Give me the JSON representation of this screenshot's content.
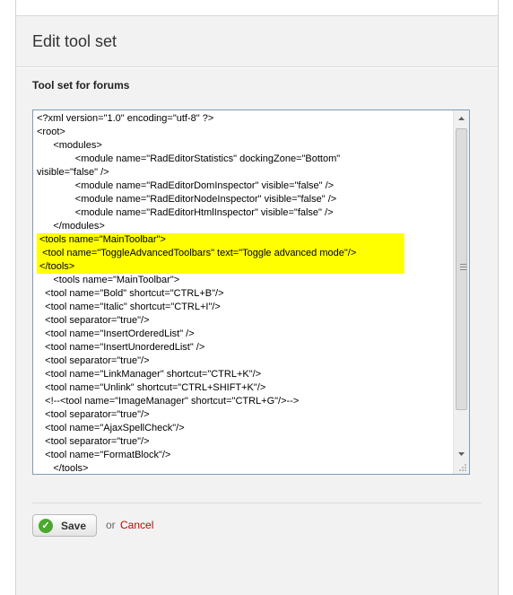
{
  "dialog": {
    "title": "Edit tool set",
    "section_label": "Tool set for forums"
  },
  "editor": {
    "lines": [
      {
        "text": "<?xml version=\"1.0\" encoding=\"utf-8\" ?>",
        "highlight": false
      },
      {
        "text": "<root>",
        "highlight": false
      },
      {
        "text": "      <modules>",
        "highlight": false
      },
      {
        "text": "              <module name=\"RadEditorStatistics\" dockingZone=\"Bottom\"",
        "highlight": false
      },
      {
        "text": "visible=\"false\" />",
        "highlight": false
      },
      {
        "text": "              <module name=\"RadEditorDomInspector\" visible=\"false\" />",
        "highlight": false
      },
      {
        "text": "              <module name=\"RadEditorNodeInspector\" visible=\"false\" />",
        "highlight": false
      },
      {
        "text": "              <module name=\"RadEditorHtmlInspector\" visible=\"false\" />",
        "highlight": false
      },
      {
        "text": "      </modules>",
        "highlight": false
      },
      {
        "text": " <tools name=\"MainToolbar\">",
        "highlight": true
      },
      {
        "text": "  <tool name=\"ToggleAdvancedToolbars\" text=\"Toggle advanced mode\"/>",
        "highlight": true
      },
      {
        "text": " </tools>",
        "highlight": true
      },
      {
        "text": "      <tools name=\"MainToolbar\">",
        "highlight": false
      },
      {
        "text": "   <tool name=\"Bold\" shortcut=\"CTRL+B\"/>",
        "highlight": false
      },
      {
        "text": "   <tool name=\"Italic\" shortcut=\"CTRL+I\"/>",
        "highlight": false
      },
      {
        "text": "   <tool separator=\"true\"/>",
        "highlight": false
      },
      {
        "text": "   <tool name=\"InsertOrderedList\" />",
        "highlight": false
      },
      {
        "text": "   <tool name=\"InsertUnorderedList\" />",
        "highlight": false
      },
      {
        "text": "   <tool separator=\"true\"/>",
        "highlight": false
      },
      {
        "text": "   <tool name=\"LinkManager\" shortcut=\"CTRL+K\"/>",
        "highlight": false
      },
      {
        "text": "   <tool name=\"Unlink\" shortcut=\"CTRL+SHIFT+K\"/>",
        "highlight": false
      },
      {
        "text": "   <!--<tool name=\"ImageManager\" shortcut=\"CTRL+G\"/>-->",
        "highlight": false
      },
      {
        "text": "   <tool separator=\"true\"/>",
        "highlight": false
      },
      {
        "text": "   <tool name=\"AjaxSpellCheck\"/>",
        "highlight": false
      },
      {
        "text": "   <tool separator=\"true\"/>",
        "highlight": false
      },
      {
        "text": "   <tool name=\"FormatBlock\"/>",
        "highlight": false
      },
      {
        "text": "      </tools>",
        "highlight": false
      }
    ]
  },
  "actions": {
    "save_label": "Save",
    "or_text": "or",
    "cancel_label": "Cancel"
  },
  "colors": {
    "highlight": "#ffff00",
    "cancel": "#cc0000",
    "check": "#4aa82f"
  }
}
